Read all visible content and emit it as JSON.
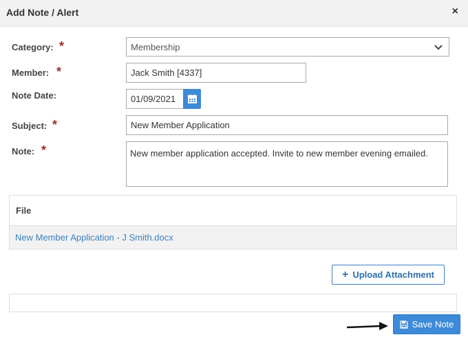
{
  "dialog": {
    "title": "Add Note / Alert",
    "close_glyph": "×"
  },
  "form": {
    "category": {
      "label": "Category:",
      "value": "Membership",
      "required_mark": "*"
    },
    "member": {
      "label": "Member:",
      "value": "Jack Smith [4337]",
      "required_mark": "*"
    },
    "note_date": {
      "label": "Note Date:",
      "value": "01/09/2021"
    },
    "subject": {
      "label": "Subject:",
      "value": "New Member Application",
      "required_mark": "*"
    },
    "note": {
      "label": "Note:",
      "value": "New member application accepted. Invite to new member evening emailed.",
      "required_mark": "*"
    }
  },
  "files": {
    "header": "File",
    "rows": [
      "New Member Application - J Smith.docx"
    ]
  },
  "buttons": {
    "upload_label": "Upload Attachment",
    "save_label": "Save Note"
  },
  "colors": {
    "primary": "#3c8ad8",
    "link": "#3a7fc1",
    "required": "#9b2d2d"
  },
  "icons": {
    "close": "close-icon",
    "dropdown": "chevron-down-icon",
    "calendar": "calendar-icon",
    "upload": "plus-icon",
    "save": "floppy-disk-icon",
    "annotation": "arrow-right-icon"
  }
}
